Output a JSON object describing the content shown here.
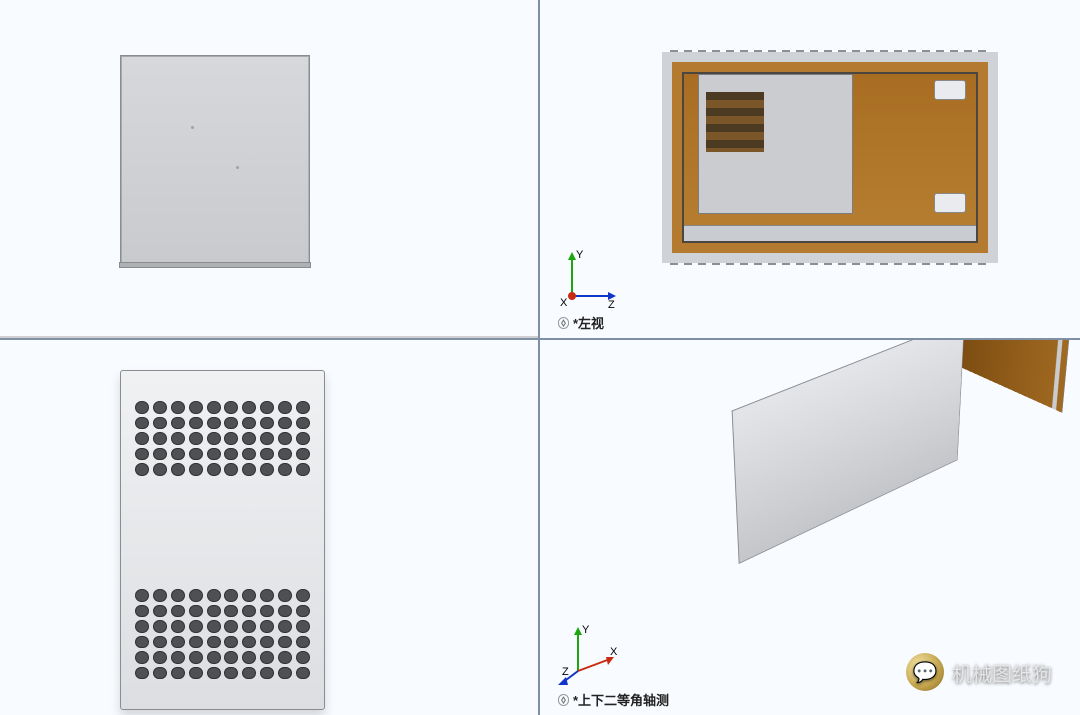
{
  "viewports": {
    "top_left": {
      "label": ""
    },
    "top_right": {
      "label": "*左视"
    },
    "bottom_left": {
      "label": ""
    },
    "bottom_right": {
      "label": "*上下二等角轴测"
    }
  },
  "axes": {
    "x": "X",
    "y": "Y",
    "z": "Z"
  },
  "watermark": {
    "text": "机械图纸狗",
    "icon": "💬"
  }
}
